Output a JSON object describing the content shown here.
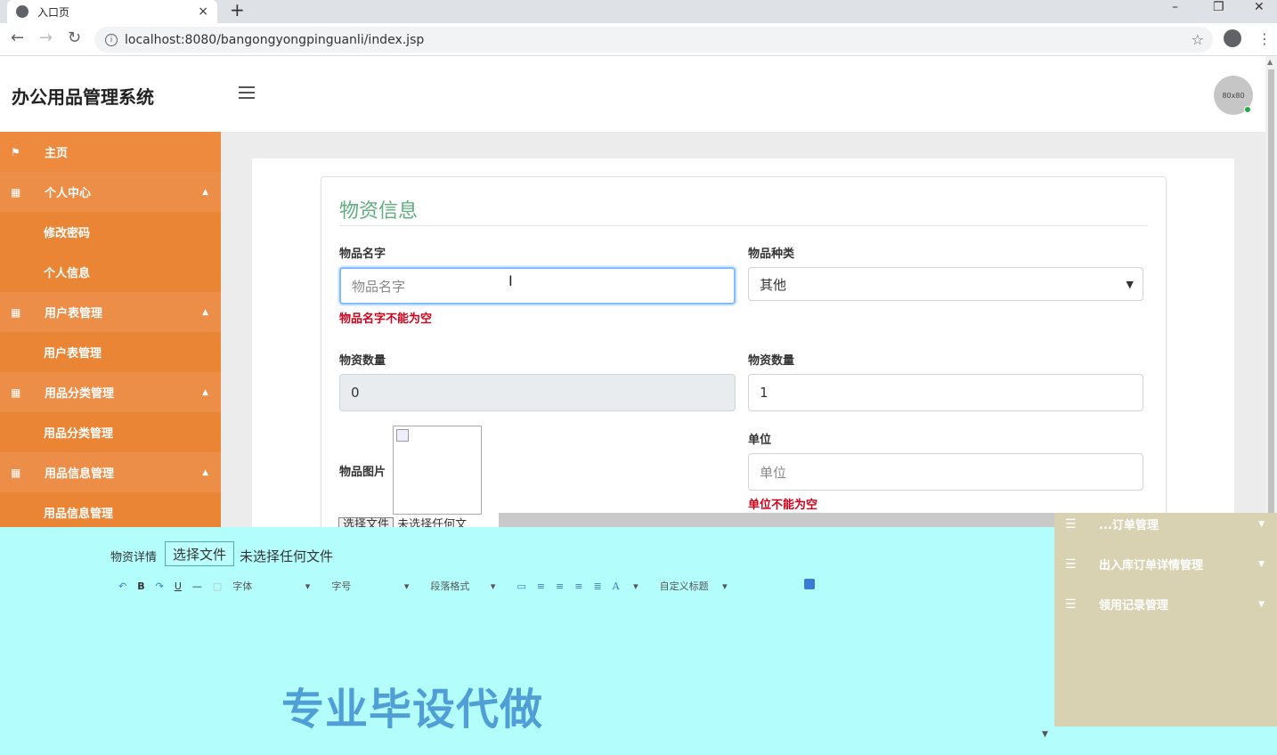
{
  "browser": {
    "tab_title": "入口页",
    "tab_close": "×",
    "new_tab": "+",
    "url": "localhost:8080/bangongyongpinguanli/index.jsp",
    "minimize": "–",
    "restore": "❐",
    "close": "✕"
  },
  "header": {
    "app_title": "办公用品管理系统",
    "avatar_text": "80x80"
  },
  "sidebar": {
    "items": [
      {
        "label": "主页",
        "icon": "flag-icon"
      },
      {
        "label": "个人中心",
        "icon": "grid-icon"
      },
      {
        "label": "修改密码"
      },
      {
        "label": "个人信息"
      },
      {
        "label": "用户表管理",
        "icon": "grid-icon"
      },
      {
        "label": "用户表管理"
      },
      {
        "label": "用品分类管理",
        "icon": "grid-icon"
      },
      {
        "label": "用品分类管理"
      },
      {
        "label": "用品信息管理",
        "icon": "grid-icon"
      },
      {
        "label": "用品信息管理"
      }
    ]
  },
  "form": {
    "title": "物资信息",
    "item_name_label": "物品名字",
    "item_name_placeholder": "物品名字",
    "item_name_error": "物品名字不能为空",
    "category_label": "物品种类",
    "category_value": "其他",
    "qty_label_left": "物资数量",
    "qty_value_left": "0",
    "qty_label_right": "物资数量",
    "qty_value_right": "1",
    "image_label": "物品图片",
    "unit_label": "单位",
    "unit_placeholder": "单位",
    "unit_error": "单位不能为空",
    "file_button_partial": "选择文件",
    "file_none_partial": "未选择任何文"
  },
  "editor": {
    "label": "物资详情",
    "file_button": "选择文件",
    "file_none": "未选择任何文件",
    "toolbar": {
      "undo": "↶",
      "bold": "B",
      "redo": "↷",
      "underline": "U",
      "hr": "—",
      "font": "字体",
      "size": "字号",
      "paragraph": "段落格式",
      "color": "A",
      "custom_title": "自定义标题"
    },
    "watermark": "专业毕设代做"
  },
  "overlay_menu": {
    "items": [
      {
        "label": "...订单管理"
      },
      {
        "label": "出入库订单详情管理"
      },
      {
        "label": "领用记录管理"
      }
    ]
  }
}
